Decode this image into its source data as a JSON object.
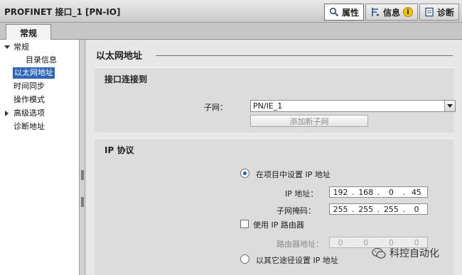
{
  "header": {
    "title": "PROFINET 接口_1 [PN-IO]",
    "tabs": [
      {
        "label": "属性",
        "icon": "properties-icon"
      },
      {
        "label": "信息",
        "icon": "info-icon"
      },
      {
        "label": "诊断",
        "icon": "diagnostics-icon"
      }
    ],
    "info_badge": "i"
  },
  "subtab": {
    "label": "常规"
  },
  "sidebar": {
    "items": [
      {
        "label": "常规"
      },
      {
        "label": "目录信息"
      },
      {
        "label": "以太网地址"
      },
      {
        "label": "时间同步"
      },
      {
        "label": "操作模式"
      },
      {
        "label": "高级选项"
      },
      {
        "label": "诊断地址"
      }
    ],
    "selected": "以太网地址"
  },
  "content": {
    "section_title": "以太网地址",
    "interface": {
      "title": "接口连接到",
      "subnet_label": "子网：",
      "subnet_value": "PN/IE_1",
      "add_subnet_button": "添加新子网"
    },
    "ip_protocol": {
      "title": "IP 协议",
      "option_set_in_project": "在项目中设置 IP 地址",
      "ip_label": "IP 地址：",
      "ip_octets": [
        "192",
        "168",
        "0",
        "45"
      ],
      "mask_label": "子网掩码：",
      "mask_octets": [
        "255",
        "255",
        "255",
        "0"
      ],
      "use_router_label": "使用 IP 路由器",
      "router_label": "路由器地址：",
      "router_octets": [
        "0",
        "0",
        "0",
        "0"
      ],
      "option_other_way": "以其它途径设置 IP 地址"
    }
  },
  "watermark": {
    "text": "科控自动化"
  },
  "colors": {
    "selection": "#2a64c5",
    "radio_dot": "#1f5fbf",
    "info_badge": "#f2c200"
  }
}
